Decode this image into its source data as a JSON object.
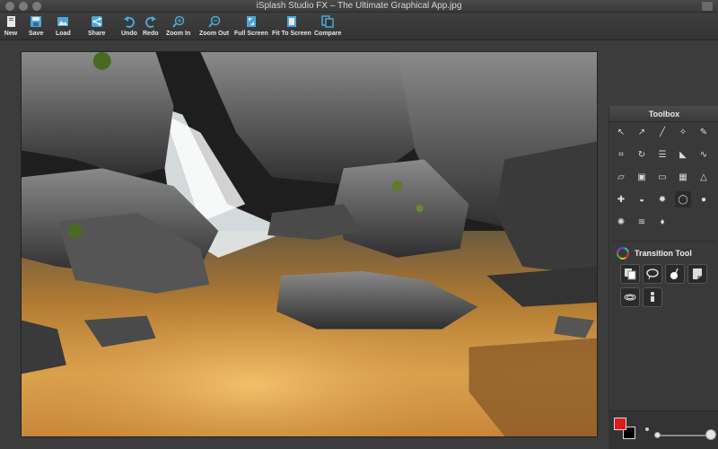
{
  "window": {
    "title": "iSplash Studio FX – The Ultimate Graphical App.jpg"
  },
  "toolbar": {
    "items": [
      {
        "label": "New",
        "icon": "new-doc-icon"
      },
      {
        "label": "Save",
        "icon": "save-icon"
      },
      {
        "label": "Load",
        "icon": "load-icon"
      },
      {
        "label": "Share",
        "icon": "share-icon"
      },
      {
        "label": "Undo",
        "icon": "undo-icon"
      },
      {
        "label": "Redo",
        "icon": "redo-icon"
      },
      {
        "label": "Zoom In",
        "icon": "zoom-in-icon"
      },
      {
        "label": "Zoom Out",
        "icon": "zoom-out-icon"
      },
      {
        "label": "Full Screen",
        "icon": "full-screen-icon"
      },
      {
        "label": "Fit To Screen",
        "icon": "fit-to-screen-icon"
      },
      {
        "label": "Compare",
        "icon": "compare-icon"
      }
    ],
    "accent": "#4aa8d8"
  },
  "toolbox": {
    "title": "Toolbox",
    "tools": [
      "select-arrow-icon",
      "eyedropper-icon",
      "brush-icon",
      "magic-wand-icon",
      "pencil-icon",
      "crop-icon",
      "rotate-icon",
      "levels-icon",
      "paint-bucket-icon",
      "curves-icon",
      "eraser-icon",
      "stamp-icon",
      "shadow-icon",
      "gradient-icon",
      "triangle-icon",
      "bandage-icon",
      "blend-icon",
      "starburst-icon",
      "circle-icon",
      "radial-gradient-icon",
      "sparkle-icon",
      "wave-icon",
      "droplet-icon"
    ],
    "active_tool": "circle-icon"
  },
  "transition_tool": {
    "title": "Transition Tool",
    "buttons": [
      "layer-copy-icon",
      "lasso-icon",
      "brush-dot-icon",
      "page-curl-icon",
      "ripple-icon",
      "person-icon"
    ]
  },
  "colors": {
    "foreground": "#e01818",
    "background": "#000000"
  }
}
